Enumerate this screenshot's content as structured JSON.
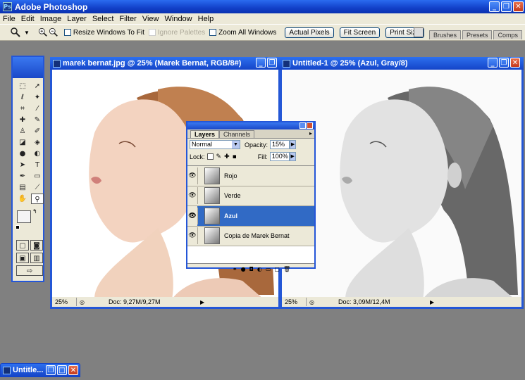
{
  "app": {
    "title": "Adobe Photoshop",
    "icon": "Ps"
  },
  "window_buttons": {
    "minimize": "_",
    "restore": "❐",
    "close": "✕"
  },
  "menu": [
    "File",
    "Edit",
    "Image",
    "Layer",
    "Select",
    "Filter",
    "View",
    "Window",
    "Help"
  ],
  "options": {
    "resize_windows": "Resize Windows To Fit",
    "ignore_palettes": "Ignore Palettes",
    "zoom_all": "Zoom All Windows",
    "actual_pixels": "Actual Pixels",
    "fit_screen": "Fit Screen",
    "print_size": "Print Size"
  },
  "palette_well": [
    "Brushes",
    "Presets",
    "Comps"
  ],
  "docs": {
    "left": {
      "title": "marek bernat.jpg @ 25% (Marek Bernat, RGB/8#)",
      "zoom": "25%",
      "info": "Doc: 9,27M/9,27M"
    },
    "right": {
      "title": "Untitled-1 @ 25% (Azul, Gray/8)",
      "zoom": "25%",
      "info": "Doc: 3,09M/12,4M"
    }
  },
  "layers_panel": {
    "tabs": [
      "Layers",
      "Channels"
    ],
    "blend_mode": "Normal",
    "opacity_label": "Opacity:",
    "opacity": "15%",
    "lock_label": "Lock:",
    "fill_label": "Fill:",
    "fill": "100%",
    "layers": [
      {
        "name": "Rojo",
        "selected": false
      },
      {
        "name": "Verde",
        "selected": false
      },
      {
        "name": "Azul",
        "selected": true
      },
      {
        "name": "Copia de Marek Bernat",
        "selected": false
      }
    ]
  },
  "taskbar": {
    "label": "Untitle..."
  },
  "colors": {
    "title_blue": "#1444c8",
    "selected_row": "#316ac5",
    "bg": "#808080"
  }
}
